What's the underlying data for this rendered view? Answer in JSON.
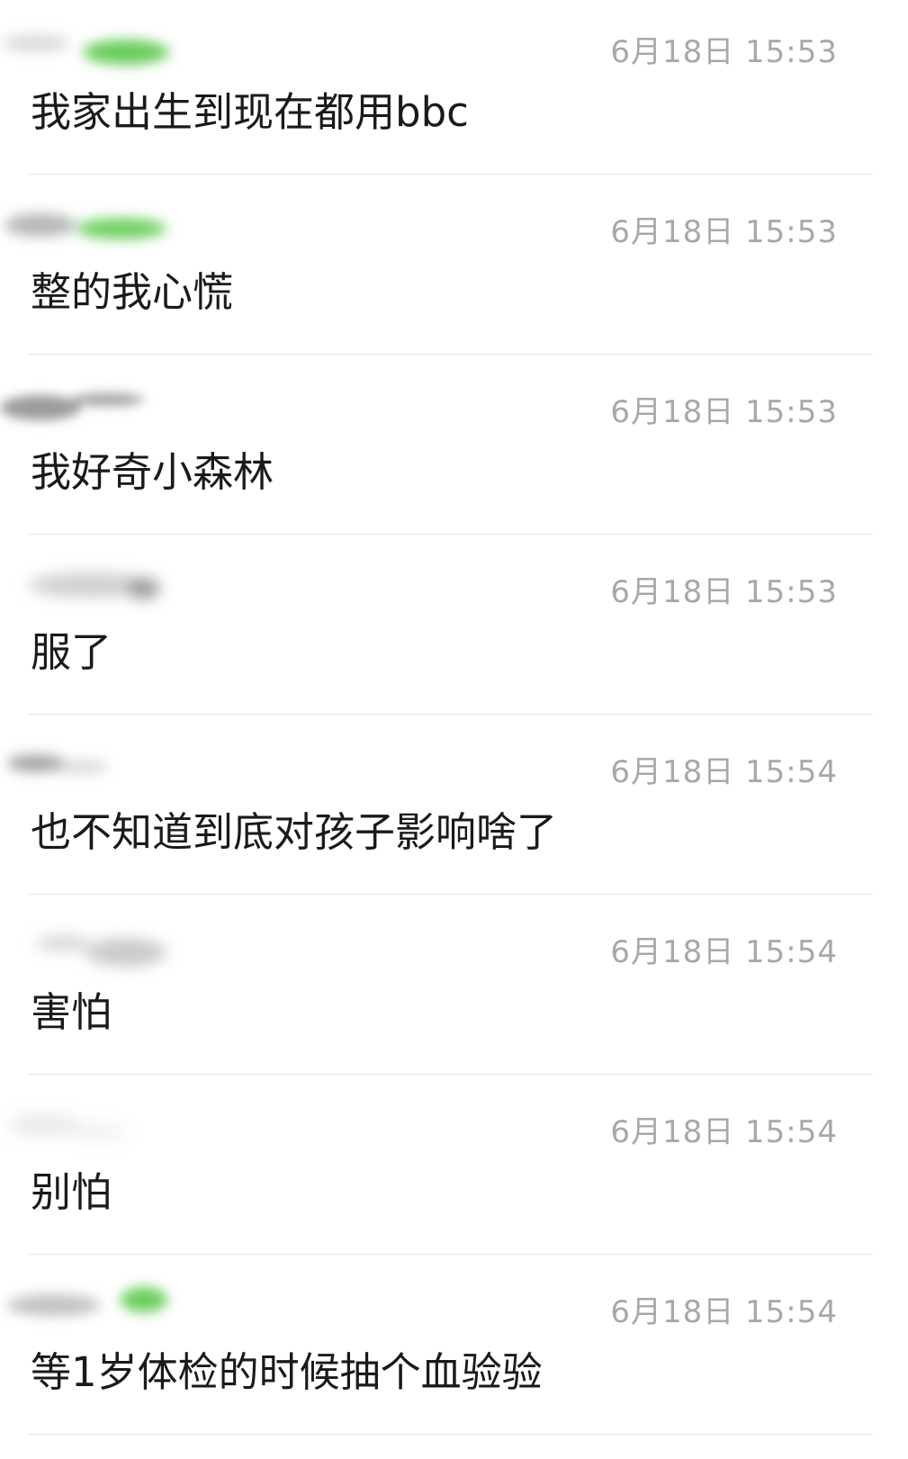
{
  "comments": [
    {
      "timestamp": "6月18日 15:53",
      "message": "我家出生到现在都用bbc",
      "name_blur": "green"
    },
    {
      "timestamp": "6月18日 15:53",
      "message": "整的我心慌",
      "name_blur": "green"
    },
    {
      "timestamp": "6月18日 15:53",
      "message": "我好奇小森林",
      "name_blur": "gray"
    },
    {
      "timestamp": "6月18日 15:53",
      "message": "服了",
      "name_blur": "gray"
    },
    {
      "timestamp": "6月18日 15:54",
      "message": "也不知道到底对孩子影响啥了",
      "name_blur": "gray"
    },
    {
      "timestamp": "6月18日 15:54",
      "message": "害怕",
      "name_blur": "gray"
    },
    {
      "timestamp": "6月18日 15:54",
      "message": "别怕",
      "name_blur": "gray"
    },
    {
      "timestamp": "6月18日 15:54",
      "message": "等1岁体检的时候抽个血验验",
      "name_blur": "green"
    }
  ],
  "colors": {
    "timestamp": "#a8a8a8",
    "message": "#1a1a1a",
    "divider": "#e4e4e4",
    "blur_green": "#5ac84a",
    "blur_gray": "#9a9a9a"
  }
}
